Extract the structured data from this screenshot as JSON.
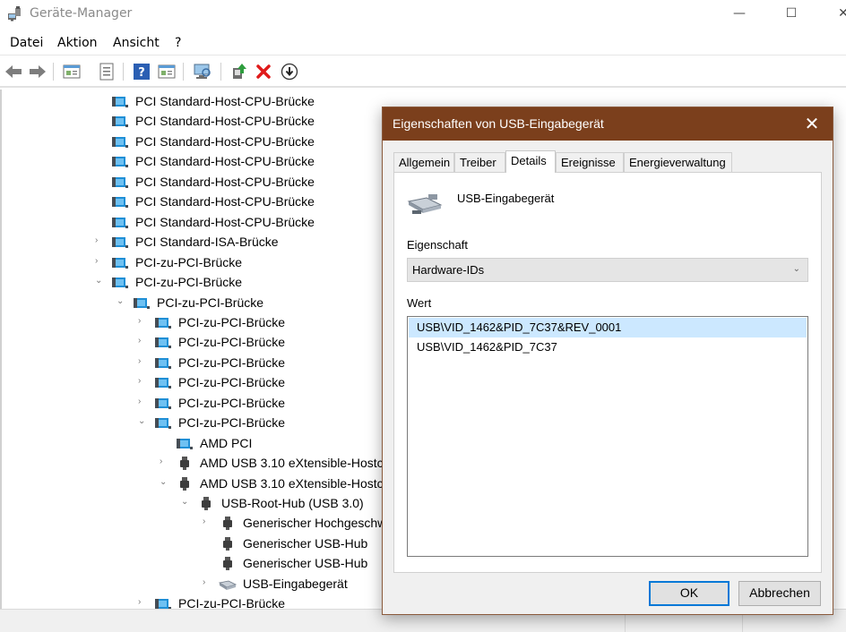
{
  "window": {
    "title": "Geräte-Manager",
    "minimize": "—",
    "maximize": "☐",
    "close": "✕"
  },
  "menu": [
    "Datei",
    "Aktion",
    "Ansicht",
    "?"
  ],
  "toolbar": {
    "buttons": [
      "back-icon",
      "forward-icon",
      "properties-view-icon",
      "device-list-icon",
      "help-icon",
      "view-icon",
      "scan-hardware-icon",
      "update-driver-icon",
      "uninstall-icon",
      "disable-icon"
    ]
  },
  "tree": {
    "rows": [
      {
        "label": "PCI Standard-Host-CPU-Brücke",
        "chevron": ""
      },
      {
        "label": "PCI Standard-Host-CPU-Brücke",
        "chevron": ""
      },
      {
        "label": "PCI Standard-Host-CPU-Brücke",
        "chevron": ""
      },
      {
        "label": "PCI Standard-Host-CPU-Brücke",
        "chevron": ""
      },
      {
        "label": "PCI Standard-Host-CPU-Brücke",
        "chevron": ""
      },
      {
        "label": "PCI Standard-Host-CPU-Brücke",
        "chevron": ""
      },
      {
        "label": "PCI Standard-Host-CPU-Brücke",
        "chevron": ""
      },
      {
        "label": "PCI Standard-ISA-Brücke",
        "chevron": "›"
      },
      {
        "label": "PCI-zu-PCI-Brücke",
        "chevron": "›"
      },
      {
        "label": "PCI-zu-PCI-Brücke",
        "chevron": "⌄"
      },
      {
        "label": "PCI-zu-PCI-Brücke",
        "chevron": "⌄"
      },
      {
        "label": "PCI-zu-PCI-Brücke",
        "chevron": "›"
      },
      {
        "label": "PCI-zu-PCI-Brücke",
        "chevron": "›"
      },
      {
        "label": "PCI-zu-PCI-Brücke",
        "chevron": "›"
      },
      {
        "label": "PCI-zu-PCI-Brücke",
        "chevron": "›"
      },
      {
        "label": "PCI-zu-PCI-Brücke",
        "chevron": "›"
      },
      {
        "label": "PCI-zu-PCI-Brücke",
        "chevron": "⌄"
      },
      {
        "label": "AMD PCI",
        "chevron": ""
      },
      {
        "label": "AMD USB 3.10 eXtensible-Hostc",
        "chevron": "›"
      },
      {
        "label": "AMD USB 3.10 eXtensible-Hostc",
        "chevron": "⌄"
      },
      {
        "label": "USB-Root-Hub (USB 3.0)",
        "chevron": "⌄"
      },
      {
        "label": "Generischer Hochgeschw",
        "chevron": "›"
      },
      {
        "label": "Generischer USB-Hub",
        "chevron": ""
      },
      {
        "label": "Generischer USB-Hub",
        "chevron": ""
      },
      {
        "label": "USB-Eingabegerät",
        "chevron": "›"
      },
      {
        "label": "PCI-zu-PCI-Brücke",
        "chevron": "›"
      }
    ]
  },
  "dialog": {
    "title": "Eigenschaften von USB-Eingabegerät",
    "close": "✕",
    "tabs": [
      "Allgemein",
      "Treiber",
      "Details",
      "Ereignisse",
      "Energieverwaltung"
    ],
    "active_tab": "Details",
    "device_name": "USB-Eingabegerät",
    "property_label": "Eigenschaft",
    "property_value": "Hardware-IDs",
    "value_label": "Wert",
    "values": [
      "USB\\VID_1462&PID_7C37&REV_0001",
      "USB\\VID_1462&PID_7C37"
    ],
    "ok_label": "OK",
    "cancel_label": "Abbrechen"
  },
  "colors": {
    "dialog_title_bg": "#7b3f1c",
    "selection_bg": "#cce8ff",
    "accent_border": "#0078d7"
  }
}
